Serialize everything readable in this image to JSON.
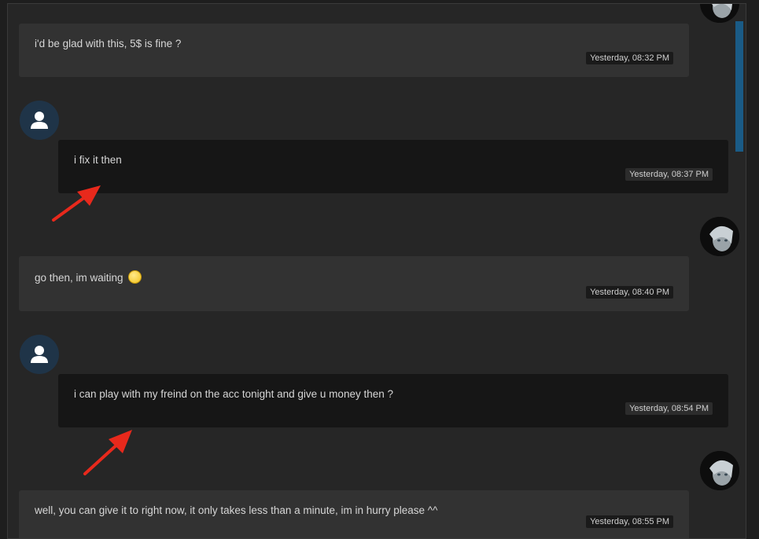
{
  "conversation": {
    "messages": [
      {
        "sender": "other",
        "text": "i'd be glad with this,  5$ is fine ?",
        "time": "Yesterday, 08:32 PM"
      },
      {
        "sender": "self",
        "text": "i fix it then",
        "time": "Yesterday, 08:37 PM"
      },
      {
        "sender": "other",
        "text": "go then, im waiting",
        "emoji": "smile-emoji",
        "time": "Yesterday, 08:40 PM"
      },
      {
        "sender": "self",
        "text": "i can play with my freind on the acc tonight and give u money then ?",
        "time": "Yesterday, 08:54 PM"
      },
      {
        "sender": "other",
        "text": "well, you can give it to right now, it only takes less than a minute, im in hurry please ^^",
        "time": "Yesterday, 08:55 PM"
      }
    ]
  },
  "icons": {
    "user_avatar": "user-icon",
    "other_avatar": "anime-portrait-avatar",
    "annotation": "red-arrow-icon"
  },
  "colors": {
    "background": "#262626",
    "other_bubble": "#323232",
    "self_bubble": "#161616",
    "avatar_bg": "#1f3448",
    "scrollbar": "#1a5b86",
    "annotation_arrow": "#e8291c"
  }
}
